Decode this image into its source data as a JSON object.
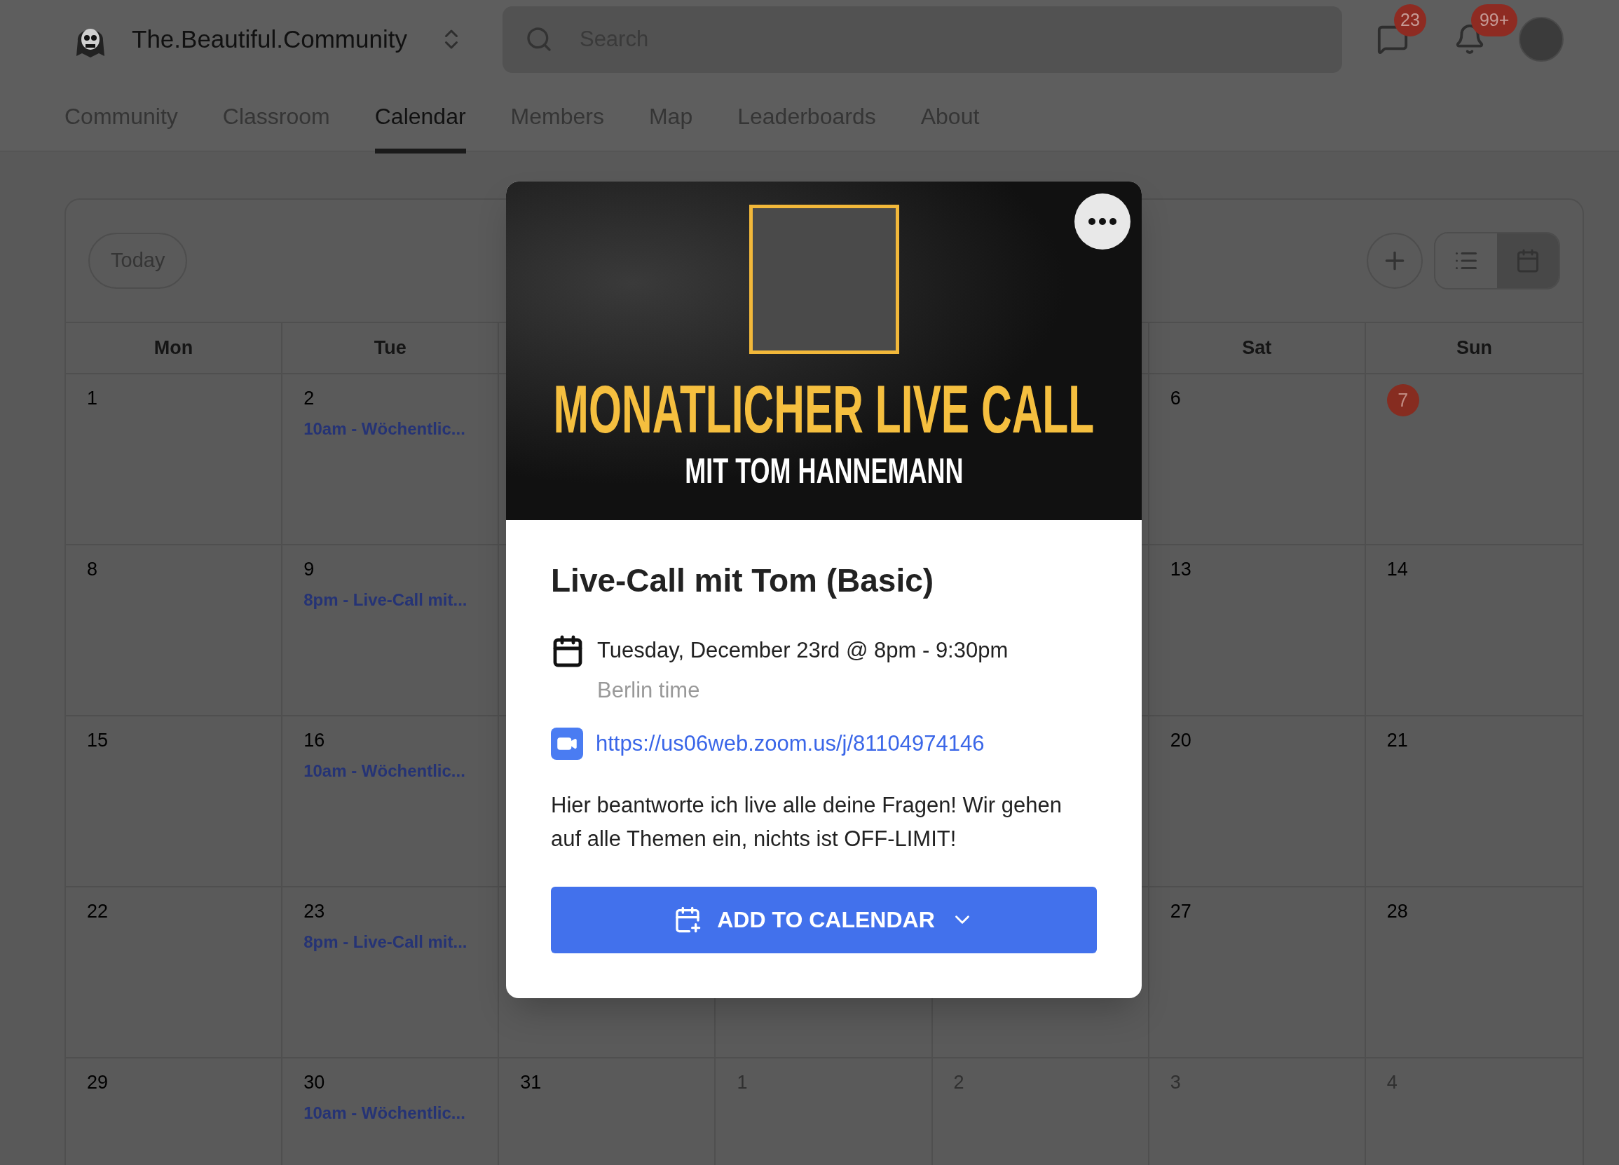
{
  "header": {
    "community_name": "The.Beautiful.Community",
    "search": {
      "placeholder": "Search"
    },
    "chat_badge": "23",
    "notification_badge": "99+"
  },
  "tabs": [
    {
      "label": "Community",
      "selected": false
    },
    {
      "label": "Classroom",
      "selected": false
    },
    {
      "label": "Calendar",
      "selected": true
    },
    {
      "label": "Members",
      "selected": false
    },
    {
      "label": "Map",
      "selected": false
    },
    {
      "label": "Leaderboards",
      "selected": false
    },
    {
      "label": "About",
      "selected": false
    }
  ],
  "calendar": {
    "today_button": "Today",
    "view_toggle": [
      {
        "kind": "list",
        "selected": false
      },
      {
        "kind": "month",
        "selected": true
      }
    ],
    "weekdays_left": [
      "Mon",
      "Tue"
    ],
    "weekdays_right": [
      "Sat",
      "Sun"
    ],
    "weeks": [
      {
        "left": [
          {
            "date": "1",
            "muted": false,
            "today": false
          },
          {
            "date": "2",
            "muted": false,
            "today": false,
            "events": [
              "10am - Wöchentlic..."
            ]
          }
        ],
        "right": [
          {
            "date": "6",
            "muted": false,
            "today": false
          },
          {
            "date": "7",
            "muted": false,
            "today": true
          }
        ]
      },
      {
        "left": [
          {
            "date": "8",
            "muted": false,
            "today": false
          },
          {
            "date": "9",
            "muted": false,
            "today": false,
            "events": [
              "8pm - Live-Call mit..."
            ]
          }
        ],
        "right": [
          {
            "date": "13",
            "muted": false,
            "today": false
          },
          {
            "date": "14",
            "muted": false,
            "today": false
          }
        ]
      },
      {
        "left": [
          {
            "date": "15",
            "muted": false,
            "today": false
          },
          {
            "date": "16",
            "muted": false,
            "today": false,
            "events": [
              "10am - Wöchentlic..."
            ]
          }
        ],
        "right": [
          {
            "date": "20",
            "muted": false,
            "today": false
          },
          {
            "date": "21",
            "muted": false,
            "today": false
          }
        ]
      },
      {
        "left": [
          {
            "date": "22",
            "muted": false,
            "today": false
          },
          {
            "date": "23",
            "muted": false,
            "today": false,
            "events": [
              "8pm - Live-Call mit..."
            ]
          }
        ],
        "right": [
          {
            "date": "27",
            "muted": false,
            "today": false
          },
          {
            "date": "28",
            "muted": false,
            "today": false
          }
        ]
      },
      {
        "days": [
          {
            "date": "29",
            "muted": false,
            "today": false
          },
          {
            "date": "30",
            "muted": false,
            "today": false,
            "events": [
              "10am - Wöchentlic..."
            ]
          },
          {
            "date": "31",
            "muted": false,
            "today": false
          },
          {
            "date": "1",
            "muted": true,
            "today": false
          },
          {
            "date": "2",
            "muted": true,
            "today": false
          },
          {
            "date": "3",
            "muted": true,
            "today": false
          },
          {
            "date": "4",
            "muted": true,
            "today": false
          }
        ]
      }
    ]
  },
  "event_popup": {
    "banner": {
      "headline": "MONATLICHER LIVE CALL",
      "subline": "MIT TOM HANNEMANN"
    },
    "title": "Live-Call mit Tom (Basic)",
    "datetime": "Tuesday, December 23rd @ 8pm - 9:30pm",
    "timezone": "Berlin time",
    "link": "https://us06web.zoom.us/j/81104974146",
    "description": "Hier beantworte ich live alle deine Fragen! Wir gehen auf alle Themen ein, nichts ist OFF-LIMIT!",
    "button": "ADD TO CALENDAR"
  }
}
